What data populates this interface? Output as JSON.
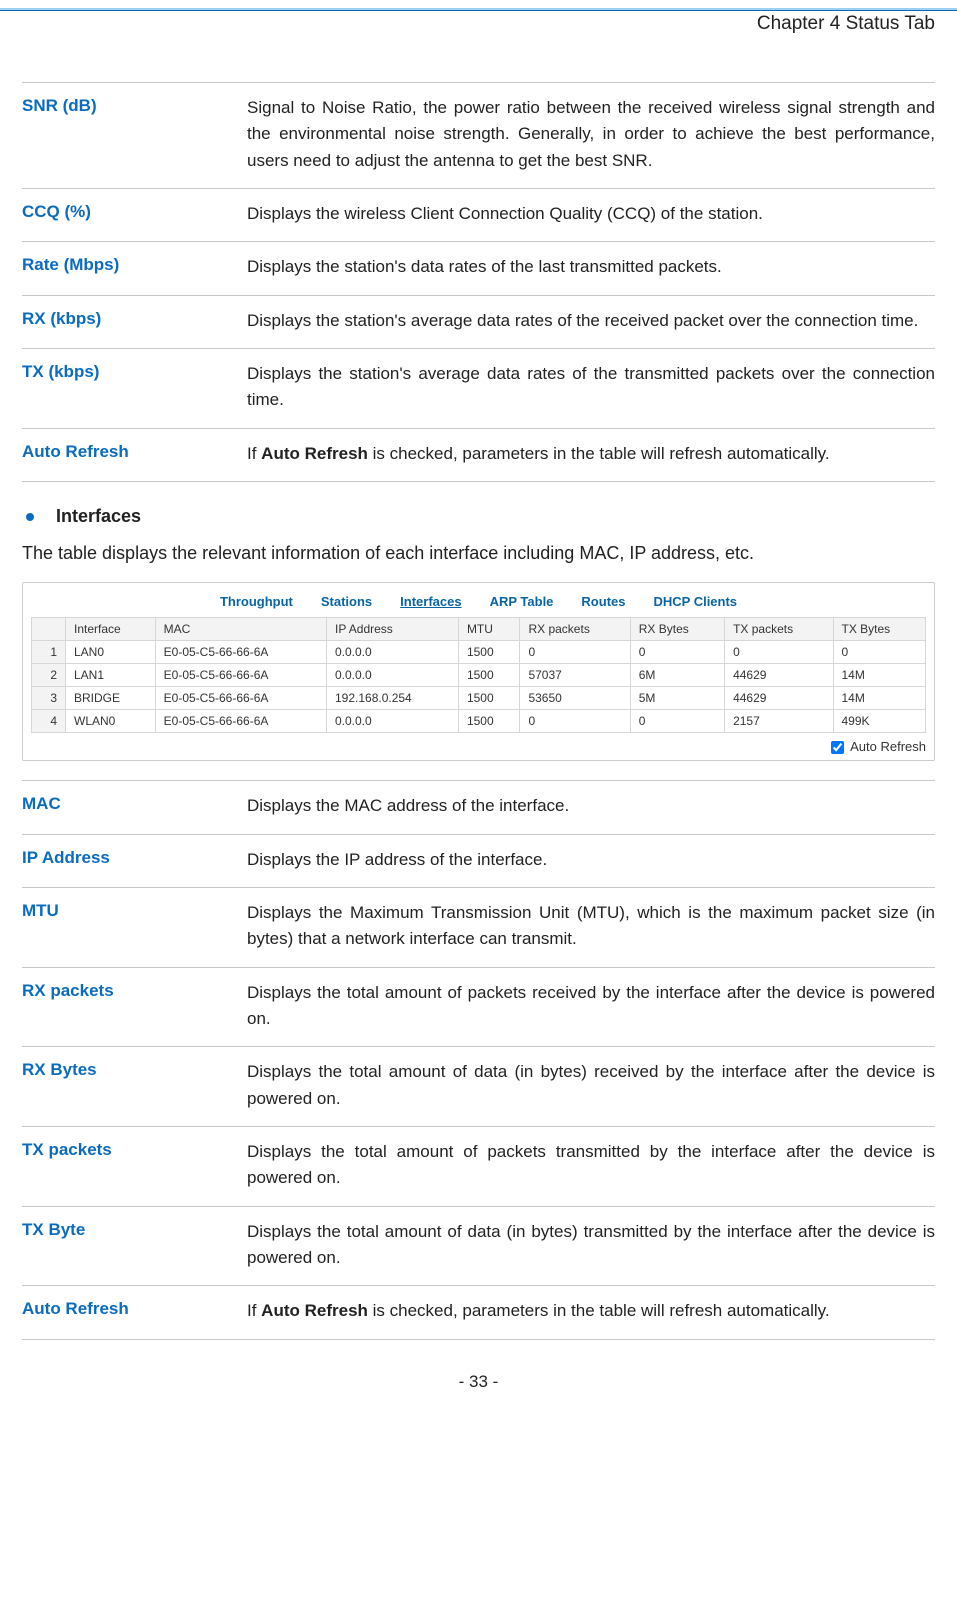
{
  "header": {
    "chapter_title": "Chapter 4 Status Tab"
  },
  "defs_top": [
    {
      "term": "SNR (dB)",
      "desc": "Signal to Noise Ratio, the power ratio between the received wireless signal strength and the environmental noise strength. Generally, in order to achieve the best performance, users need to adjust the antenna to get the best SNR."
    },
    {
      "term": "CCQ (%)",
      "desc": "Displays the wireless Client Connection Quality (CCQ) of the station."
    },
    {
      "term": "Rate (Mbps)",
      "desc": "Displays the station's data rates of the last transmitted packets."
    },
    {
      "term": "RX (kbps)",
      "desc": "Displays the station's average data rates of the received packet over the connection time."
    },
    {
      "term": "TX (kbps)",
      "desc": "Displays the station's average data rates of the transmitted packets over the connection time."
    }
  ],
  "auto_refresh_top": {
    "term": "Auto Refresh",
    "prefix": "If ",
    "bold": "Auto Refresh",
    "suffix": " is checked, parameters in the table will refresh automatically."
  },
  "section": {
    "bullet_title": "Interfaces",
    "intro": "The table displays the relevant information of each interface including MAC, IP address, etc."
  },
  "panel": {
    "tabs": [
      "Throughput",
      "Stations",
      "Interfaces",
      "ARP Table",
      "Routes",
      "DHCP Clients"
    ],
    "active_tab_index": 2,
    "columns": [
      "",
      "Interface",
      "MAC",
      "IP Address",
      "MTU",
      "RX packets",
      "RX Bytes",
      "TX packets",
      "TX Bytes"
    ],
    "rows": [
      {
        "idx": "1",
        "iface": "LAN0",
        "mac": "E0-05-C5-66-66-6A",
        "ip": "0.0.0.0",
        "mtu": "1500",
        "rxp": "0",
        "rxb": "0",
        "txp": "0",
        "txb": "0"
      },
      {
        "idx": "2",
        "iface": "LAN1",
        "mac": "E0-05-C5-66-66-6A",
        "ip": "0.0.0.0",
        "mtu": "1500",
        "rxp": "57037",
        "rxb": "6M",
        "txp": "44629",
        "txb": "14M"
      },
      {
        "idx": "3",
        "iface": "BRIDGE",
        "mac": "E0-05-C5-66-66-6A",
        "ip": "192.168.0.254",
        "mtu": "1500",
        "rxp": "53650",
        "rxb": "5M",
        "txp": "44629",
        "txb": "14M"
      },
      {
        "idx": "4",
        "iface": "WLAN0",
        "mac": "E0-05-C5-66-66-6A",
        "ip": "0.0.0.0",
        "mtu": "1500",
        "rxp": "0",
        "rxb": "0",
        "txp": "2157",
        "txb": "499K"
      }
    ],
    "auto_refresh_label": "Auto Refresh"
  },
  "defs_bottom": [
    {
      "term": "MAC",
      "desc": "Displays the MAC address of the interface."
    },
    {
      "term": "IP Address",
      "desc": "Displays the IP address of the interface."
    },
    {
      "term": "MTU",
      "desc": "Displays the Maximum Transmission Unit (MTU), which is the maximum packet size (in bytes) that a network interface can transmit."
    },
    {
      "term": "RX packets",
      "desc": "Displays the total amount of packets received by the interface after the device is powered on."
    },
    {
      "term": "RX Bytes",
      "desc": "Displays the total amount of data (in bytes) received by the interface after the device is powered on."
    },
    {
      "term": "TX packets",
      "desc": "Displays the total amount of packets transmitted by the interface after the device is powered on."
    },
    {
      "term": "TX Byte",
      "desc": "Displays the total amount of data (in bytes) transmitted by the interface after the device is powered on."
    }
  ],
  "auto_refresh_bottom": {
    "term": "Auto Refresh",
    "prefix": "If ",
    "bold": "Auto Refresh",
    "suffix": " is checked, parameters in the table will refresh automatically."
  },
  "page_number": "- 33 -"
}
